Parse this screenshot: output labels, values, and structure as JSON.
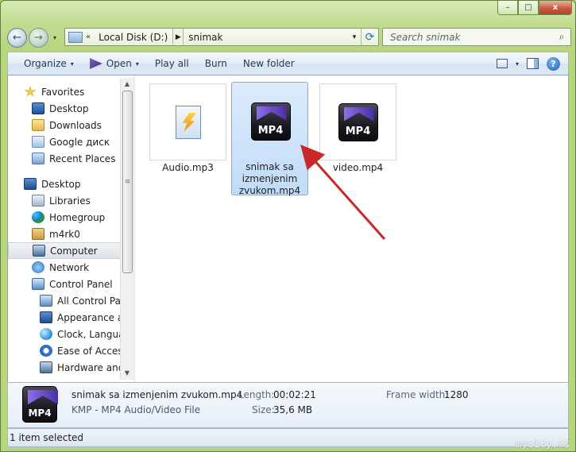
{
  "window": {
    "controls": {
      "minimize": "–",
      "maximize": "□",
      "close": "x"
    }
  },
  "address": {
    "overflow": "«",
    "segments": [
      "Local Disk (D:)",
      "snimak"
    ],
    "separator": "▶",
    "dropdown": "▾",
    "refresh": "⟳"
  },
  "nav": {
    "back": "←",
    "forward": "→",
    "history": "▾"
  },
  "search": {
    "placeholder": "Search snimak",
    "icon": "⌕"
  },
  "toolbar": {
    "organize": "Organize",
    "open": "Open",
    "play_all": "Play all",
    "burn": "Burn",
    "new_folder": "New folder",
    "caret": "▾",
    "help": "?"
  },
  "sidebar": {
    "items": [
      {
        "label": "Favorites",
        "icon": "star-icon"
      },
      {
        "label": "Desktop",
        "icon": "desktop-icon"
      },
      {
        "label": "Downloads",
        "icon": "downloads-icon"
      },
      {
        "label": "Google диск",
        "icon": "google-disk-icon"
      },
      {
        "label": "Recent Places",
        "icon": "recent-places-icon"
      },
      {
        "label": "Desktop",
        "icon": "desktop-icon"
      },
      {
        "label": "Libraries",
        "icon": "libraries-icon"
      },
      {
        "label": "Homegroup",
        "icon": "homegroup-icon"
      },
      {
        "label": "m4rk0",
        "icon": "user-folder-icon"
      },
      {
        "label": "Computer",
        "icon": "computer-icon"
      },
      {
        "label": "Network",
        "icon": "network-icon"
      },
      {
        "label": "Control Panel",
        "icon": "control-panel-icon"
      },
      {
        "label": "All Control Pan",
        "icon": "control-panel-icon"
      },
      {
        "label": "Appearance an",
        "icon": "appearance-icon"
      },
      {
        "label": "Clock, Languag",
        "icon": "globe-icon"
      },
      {
        "label": "Ease of Access",
        "icon": "ease-of-access-icon"
      },
      {
        "label": "Hardware and S",
        "icon": "hardware-icon"
      }
    ],
    "scroll_grip": "≡",
    "scroll_up": "▲",
    "scroll_down": "▼"
  },
  "files": [
    {
      "name": "Audio.mp3",
      "icon": "mp3-file-icon",
      "selected": false
    },
    {
      "name": "snimak sa izmenjenim zvukom.mp4",
      "name_lines": [
        "snimak sa",
        "izmenjenim",
        "zvukom.mp4"
      ],
      "icon": "mp4-file-icon",
      "badge": "MP4",
      "selected": true
    },
    {
      "name": "video.mp4",
      "icon": "mp4-file-icon",
      "badge": "MP4",
      "selected": false
    }
  ],
  "details": {
    "badge": "MP4",
    "name": "snimak sa izmenjenim zvukom.mp4",
    "type": "KMP - MP4 Audio/Video File",
    "length_label": "Length:",
    "length": "00:02:21",
    "size_label": "Size:",
    "size": "35,6 MB",
    "frame_width_label": "Frame width:",
    "frame_width": "1280"
  },
  "status": {
    "text": "1 item selected"
  },
  "watermark": "mycity.rs",
  "colors": {
    "accent_arrow": "#c8282a",
    "selection": "#c1dcf7",
    "window_frame": "#b7d57e"
  }
}
